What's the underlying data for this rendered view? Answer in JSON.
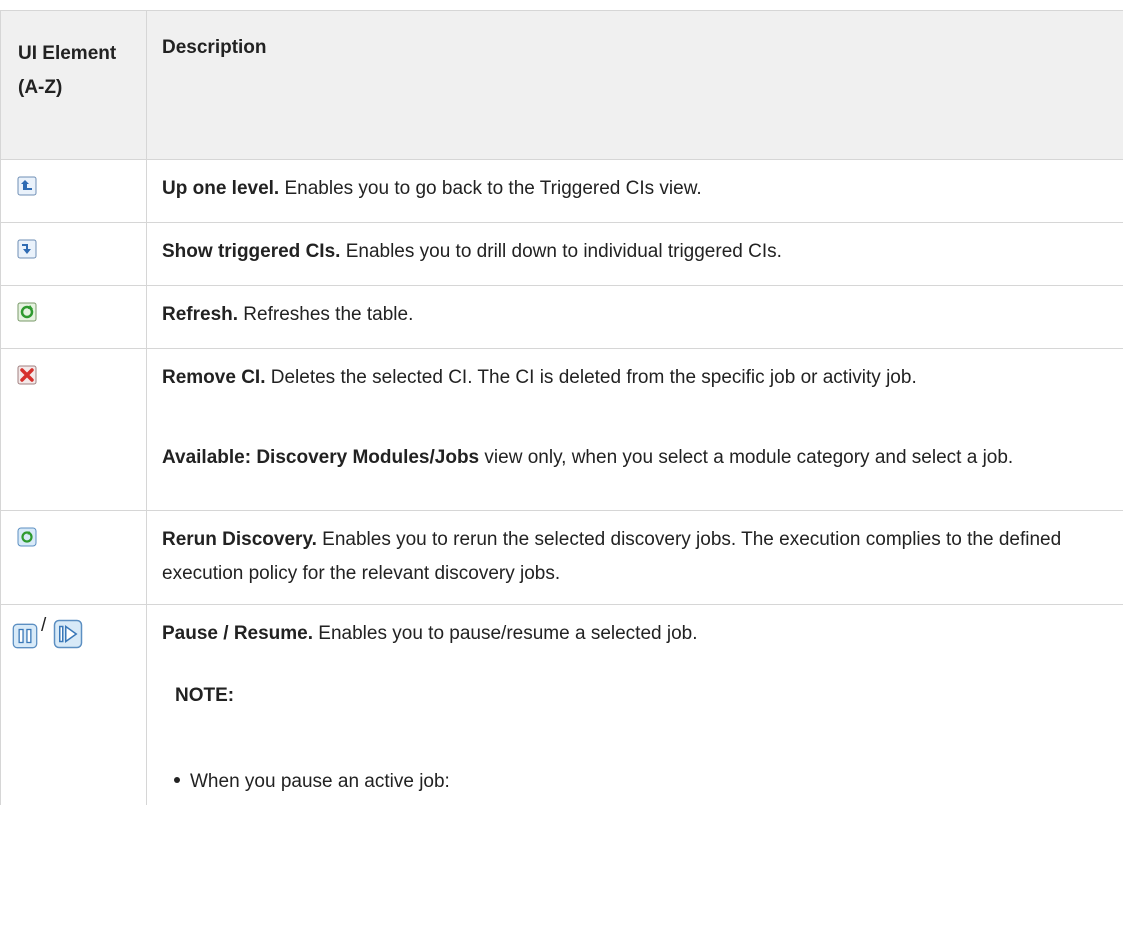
{
  "header": {
    "col1": "UI Element (A-Z)",
    "col2": "Description"
  },
  "rows": [
    {
      "icon": "up-one-level-icon",
      "title": "Up one level.",
      "text": " Enables you to go back to the Triggered CIs view."
    },
    {
      "icon": "show-triggered-cis-icon",
      "title": "Show triggered CIs.",
      "text": " Enables you to drill down to individual triggered CIs."
    },
    {
      "icon": "refresh-icon",
      "title": "Refresh.",
      "text": " Refreshes the table."
    },
    {
      "icon": "remove-ci-icon",
      "title": "Remove CI.",
      "text": " Deletes the selected CI. The CI is deleted from the specific job or activity job.",
      "avail_label": "Available: Discovery Modules/Jobs",
      "avail_text": " view only, when you select a module category and select a job."
    },
    {
      "icon": "rerun-discovery-icon",
      "title": "Rerun Discovery.",
      "text": " Enables you to rerun the selected discovery jobs. The execution complies to the defined execution policy for the relevant discovery jobs."
    },
    {
      "icon": "pause-resume-icon",
      "separator": "/",
      "title": "Pause / Resume.",
      "text": " Enables you to pause/resume a selected job.",
      "note_label": "NOTE:",
      "bullet_text": "When you pause an active job:"
    }
  ]
}
